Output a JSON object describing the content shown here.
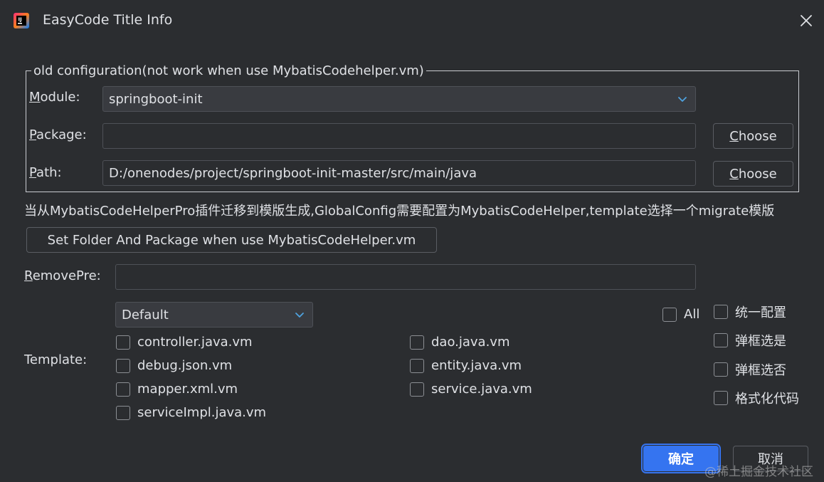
{
  "window": {
    "title": "EasyCode Title Info",
    "close_icon": "close-icon"
  },
  "old_config": {
    "legend": "old configuration(not work when use MybatisCodehelper.vm)",
    "module": {
      "mnemonic": "M",
      "label_rest": "odule:",
      "value": "springboot-init"
    },
    "package": {
      "mnemonic": "P",
      "label_rest": "ackage:",
      "value": "",
      "choose_mnemonic": "C",
      "choose_rest": "hoose"
    },
    "path": {
      "mnemonic": "P",
      "label_rest": "ath:",
      "value": "D:/onenodes/project/springboot-init-master/src/main/java",
      "choose_mnemonic": "C",
      "choose_rest": "hoose"
    }
  },
  "hint_text": "当从MybatisCodeHelperPro插件迁移到模版生成,GlobalConfig需要配置为MybatisCodeHelper,template选择一个migrate模版",
  "set_folder_button": "Set Folder And Package  when use MybatisCodeHelper.vm",
  "remove_pre": {
    "mnemonic": "R",
    "label_rest": "emovePre:",
    "value": ""
  },
  "template": {
    "label": "Template:",
    "group_selected": "Default",
    "all_label": "All",
    "items_col1": [
      "controller.java.vm",
      "debug.json.vm",
      "mapper.xml.vm",
      "serviceImpl.java.vm"
    ],
    "items_col2": [
      "dao.java.vm",
      "entity.java.vm",
      "service.java.vm"
    ]
  },
  "options": [
    "统一配置",
    "弹框选是",
    "弹框选否",
    "格式化代码"
  ],
  "footer": {
    "ok": "确定",
    "cancel": "取消"
  },
  "watermark": "@稀土掘金技术社区",
  "colors": {
    "background": "#2b2d30",
    "accent": "#3574f0",
    "text": "#dfe1e5",
    "border": "#4e5157"
  }
}
